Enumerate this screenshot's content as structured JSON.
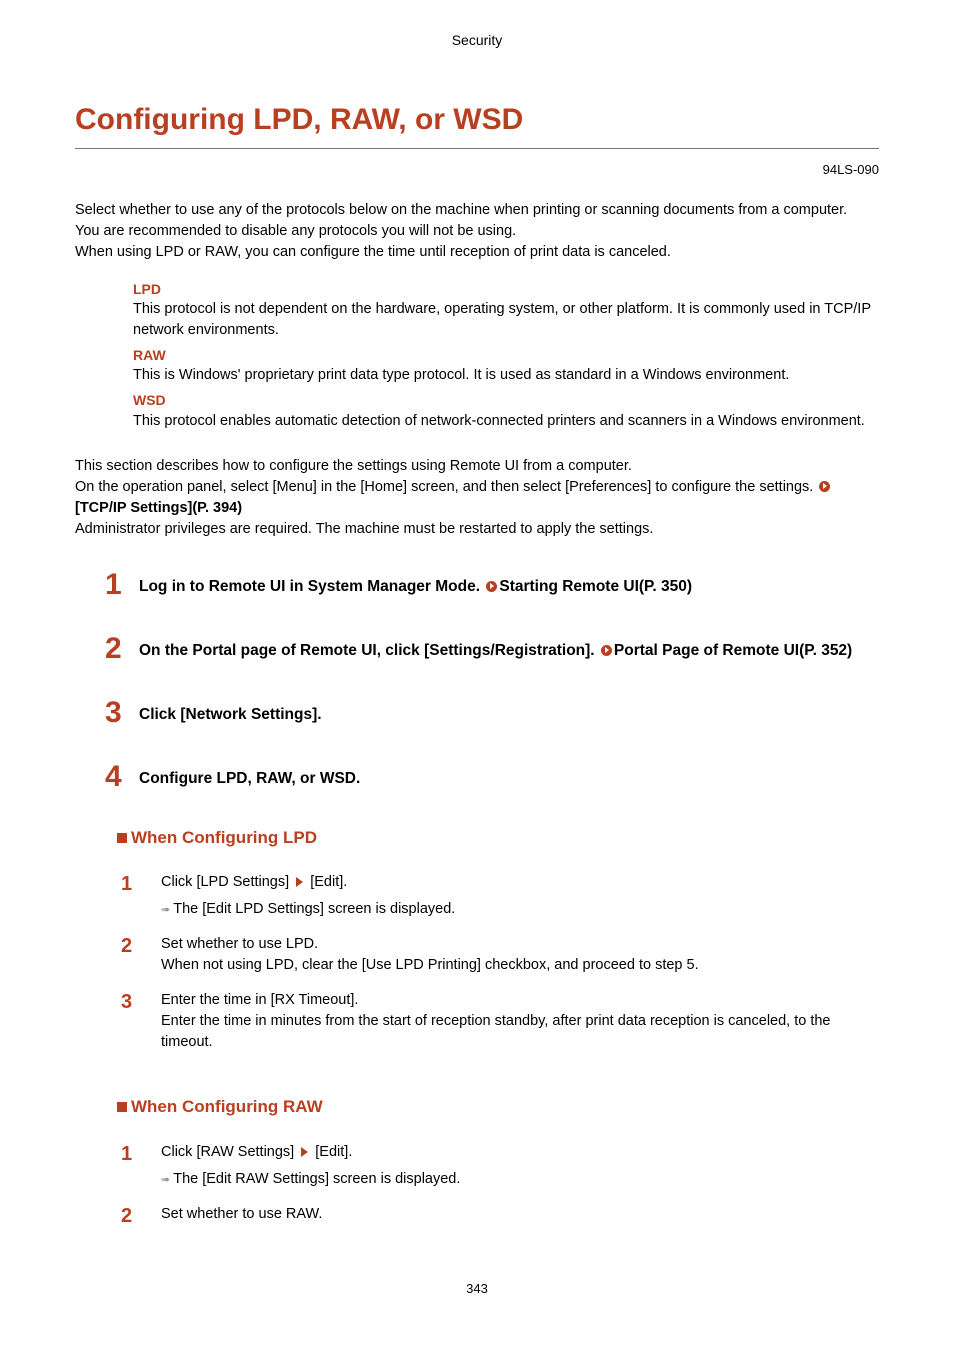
{
  "section_header": "Security",
  "title": "Configuring LPD, RAW, or WSD",
  "doc_code": "94LS-090",
  "intro": {
    "p1": "Select whether to use any of the protocols below on the machine when printing or scanning documents from a computer.",
    "p2": "You are recommended to disable any protocols you will not be using.",
    "p3": "When using LPD or RAW, you can configure the time until reception of print data is canceled."
  },
  "defs": {
    "lpd_t": "LPD",
    "lpd_d": "This protocol is not dependent on the hardware, operating system, or other platform. It is commonly used in TCP/IP network environments.",
    "raw_t": "RAW",
    "raw_d": "This is Windows' proprietary print data type protocol. It is used as standard in a Windows environment.",
    "wsd_t": "WSD",
    "wsd_d": "This protocol enables automatic detection of network-connected printers and scanners in a Windows environment."
  },
  "mid": {
    "p1": "This section describes how to configure the settings using Remote UI from a computer.",
    "p2a": "On the operation panel, select [Menu] in the [Home] screen, and then select [Preferences] to configure the settings. ",
    "p2b": "[TCP/IP Settings](P. 394)",
    "p3": "Administrator privileges are required. The machine must be restarted to apply the settings."
  },
  "steps": {
    "s1a": "Log in to Remote UI in System Manager Mode. ",
    "s1b": "Starting Remote UI(P. 350)",
    "s2a": "On the Portal page of Remote UI, click [Settings/Registration]. ",
    "s2b": "Portal Page of Remote UI(P. 352)",
    "s3": "Click [Network Settings].",
    "s4": "Configure LPD, RAW, or WSD."
  },
  "lpd_section": {
    "heading": "When Configuring LPD",
    "i1a": "Click [LPD Settings]",
    "i1b": "[Edit].",
    "i1c": "The [Edit LPD Settings] screen is displayed.",
    "i2a": "Set whether to use LPD.",
    "i2b": "When not using LPD, clear the [Use LPD Printing] checkbox, and proceed to step 5.",
    "i3a": "Enter the time in [RX Timeout].",
    "i3b": "Enter the time in minutes from the start of reception standby, after print data reception is canceled, to the timeout."
  },
  "raw_section": {
    "heading": "When Configuring RAW",
    "i1a": "Click [RAW Settings]",
    "i1b": "[Edit].",
    "i1c": "The [Edit RAW Settings] screen is displayed.",
    "i2a": "Set whether to use RAW."
  },
  "page_number": "343"
}
